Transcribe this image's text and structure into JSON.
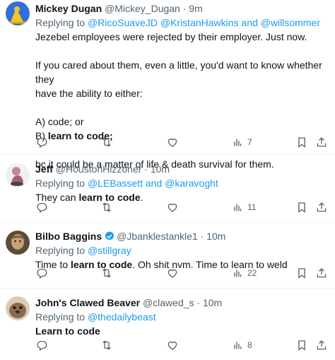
{
  "colors": {
    "link": "#1d9bf0",
    "muted": "#536471",
    "text": "#0f1419"
  },
  "tweets": [
    {
      "name": "Mickey Dugan",
      "handle": "@Mickey_Dugan",
      "dot": "·",
      "time": "9m",
      "replying_prefix": "Replying to ",
      "mention1": "@RicoSuaveJD",
      "mention2": "@KristanHawkins",
      "and": " and ",
      "mention3": "@willsommer",
      "lines": {
        "l1": "Jezebel employees were rejected by their employer. Just now.",
        "l2": "If you cared about them, even a little, you'd want to know whether they",
        "l3": "have the ability to either:",
        "l4": "A) code; or",
        "l5a": "B) ",
        "l5b": "learn to code;",
        "l6": "bc it could be a matter of life & death survival for them."
      },
      "views": "7"
    },
    {
      "name": "Jeff",
      "handle": "@HoustonHizzoner",
      "dot": "·",
      "time": "10m",
      "replying_prefix": "Replying to ",
      "mention1": "@LEBassett",
      "and": " and ",
      "mention2": "@karavoght",
      "text_a": "They can ",
      "text_b": "learn to code",
      "text_c": ".",
      "views": "11"
    },
    {
      "name": "Bilbo Baggins",
      "handle": "@Jbanklestankle1",
      "dot": "·",
      "time": "10m",
      "replying_prefix": "Replying to ",
      "mention1": "@stillgray",
      "text_a": "Time to ",
      "text_b": "learn to code",
      "text_c": ". Oh shit nvm. Time to learn to weld",
      "views": "22"
    },
    {
      "name": "John's Clawed Beaver",
      "handle": "@clawed_s",
      "dot": "·",
      "time": "10m",
      "replying_prefix": "Replying to ",
      "mention1": "@thedailybeast",
      "text_b": "Learn to code",
      "views": "8"
    }
  ],
  "icons": {
    "reply": "reply-icon",
    "retweet": "retweet-icon",
    "like": "heart-icon",
    "views": "views-icon",
    "bookmark": "bookmark-icon",
    "share": "share-icon",
    "verified": "verified-badge-icon"
  }
}
